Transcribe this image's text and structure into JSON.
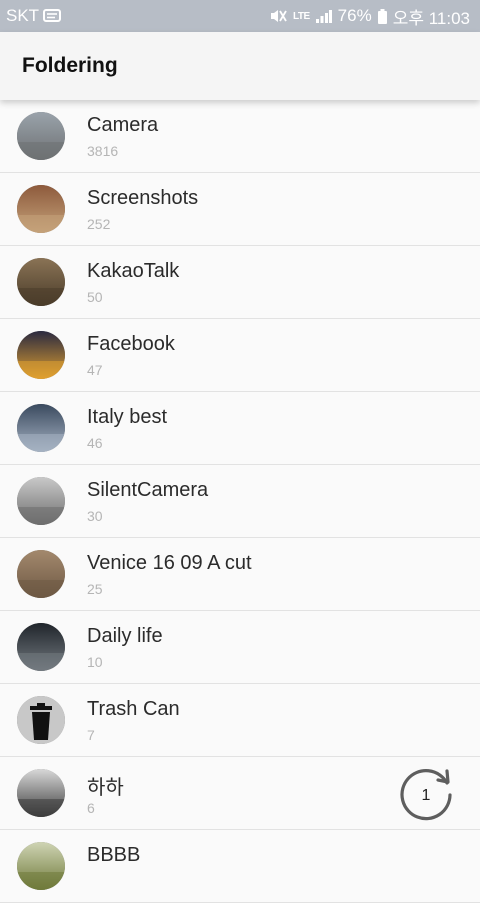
{
  "status_bar": {
    "carrier": "SKT",
    "network": "LTE",
    "battery": "76%",
    "time": "오후 11:03"
  },
  "app_bar": {
    "title": "Foldering"
  },
  "folders": [
    {
      "name": "Camera",
      "count": "3816",
      "thumb_colors": [
        "#9aa3ab",
        "#6e7173"
      ]
    },
    {
      "name": "Screenshots",
      "count": "252",
      "thumb_colors": [
        "#8d5a3c",
        "#c5a27a"
      ]
    },
    {
      "name": "KakaoTalk",
      "count": "50",
      "thumb_colors": [
        "#8a7355",
        "#4a3c2a"
      ]
    },
    {
      "name": "Facebook",
      "count": "47",
      "thumb_colors": [
        "#2a2a40",
        "#e0a030"
      ]
    },
    {
      "name": "Italy best",
      "count": "46",
      "thumb_colors": [
        "#3a4a5f",
        "#a6b2c2"
      ]
    },
    {
      "name": "SilentCamera",
      "count": "30",
      "thumb_colors": [
        "#c9c9c9",
        "#6e6e6e"
      ]
    },
    {
      "name": "Venice 16 09 A cut",
      "count": "25",
      "thumb_colors": [
        "#a3896d",
        "#6e5944"
      ]
    },
    {
      "name": "Daily life",
      "count": "10",
      "thumb_colors": [
        "#20252b",
        "#737a80"
      ]
    },
    {
      "name": "Trash Can",
      "count": "7",
      "thumb_colors": [
        "#c8c8c8",
        "#111111"
      ]
    },
    {
      "name": "하하",
      "count": "6",
      "thumb_colors": [
        "#d8d8d8",
        "#3d3d3d"
      ]
    },
    {
      "name": "BBBB",
      "count": "",
      "thumb_colors": [
        "#cfd4b4",
        "#6f7a3a"
      ]
    }
  ],
  "fab": {
    "icon": "refresh-icon",
    "count": "1"
  }
}
